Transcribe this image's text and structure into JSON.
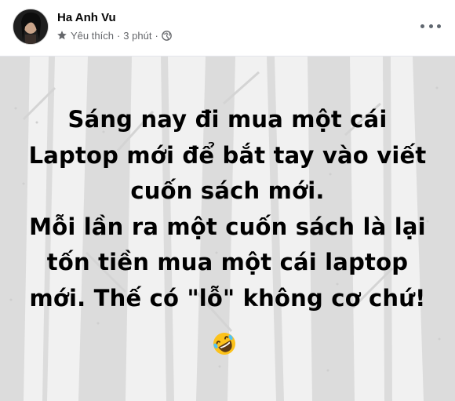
{
  "post": {
    "author": "Ha Anh Vu",
    "audience_label": "Yêu thích",
    "separator": "·",
    "time": "3 phút",
    "privacy_icon": "globe-icon",
    "star_icon": "star-icon",
    "more_icon": "more-options-icon",
    "text_lines": [
      "Sáng nay đi mua một cái",
      "Laptop mới để bắt tay vào viết",
      "cuốn sách mới.",
      "Mỗi lần ra một cuốn sách là lại",
      "tốn tiền mua một cái laptop",
      "mới. Thế có \"lỗ\" không cơ chứ!"
    ],
    "emoji": "rolling-on-floor-laughing-emoji"
  },
  "colors": {
    "name": "#050505",
    "meta": "#65676b",
    "background": "#f1f1f1",
    "tree": "#d8d8d8",
    "text": "#000000"
  }
}
